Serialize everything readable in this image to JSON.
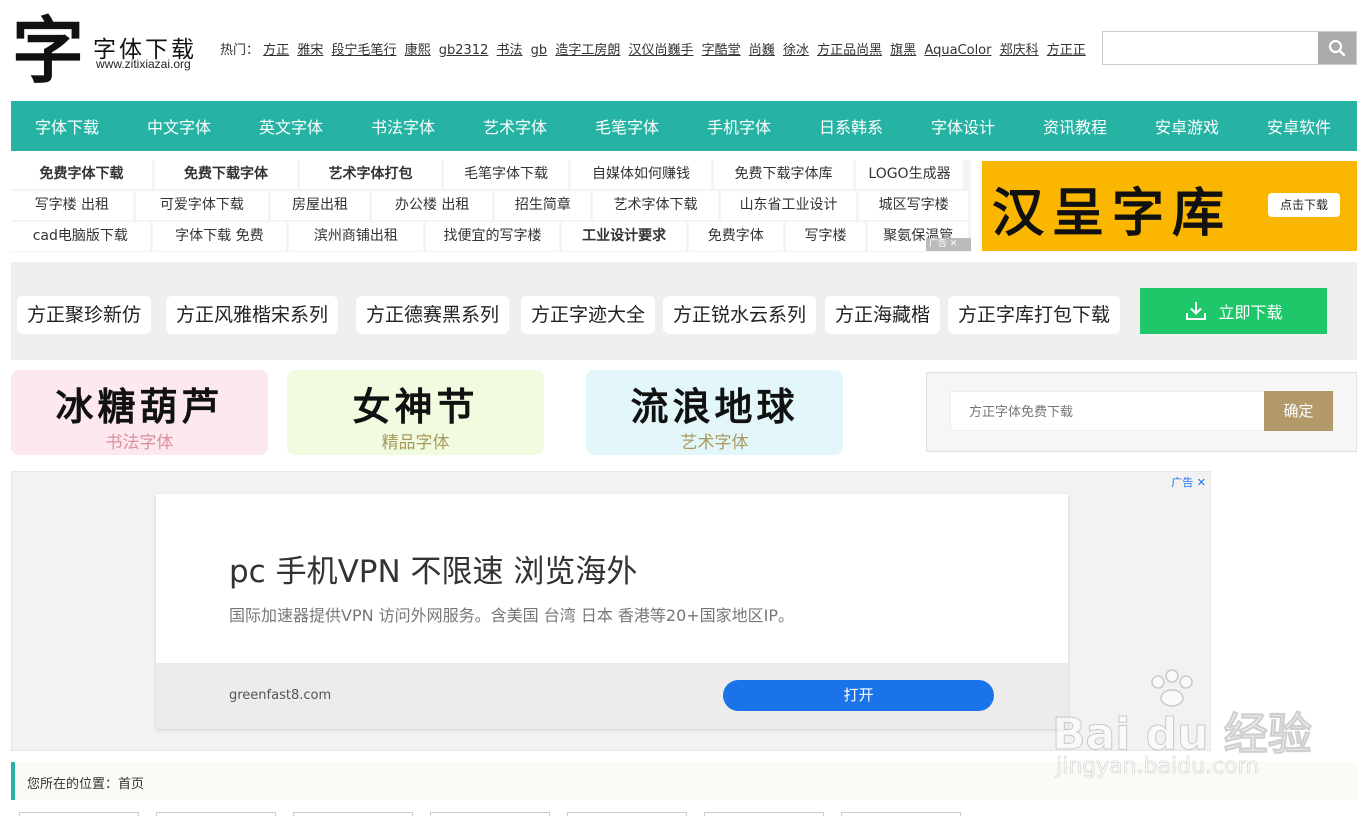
{
  "header": {
    "logo_glyph": "字",
    "logo_title": "字体下载",
    "logo_url": "www.zitixiazai.org",
    "hot_label": "热门：",
    "hot_links": [
      "方正",
      "雅宋",
      "段宁毛笔行",
      "康熙",
      "gb2312",
      "书法",
      "gb",
      "造字工房朗",
      "汉仪尚巍手",
      "字酷堂",
      "尚巍",
      "徐冰",
      "方正品尚黑",
      "旗黑",
      "AquaColor",
      "郑庆科",
      "方正正"
    ],
    "search_placeholder": ""
  },
  "nav": [
    "字体下载",
    "中文字体",
    "英文字体",
    "书法字体",
    "艺术字体",
    "毛笔字体",
    "手机字体",
    "日系韩系",
    "字体设计",
    "资讯教程",
    "安卓游戏",
    "安卓软件"
  ],
  "keywords": {
    "rows": [
      [
        "免费字体下载",
        "免费下载字体",
        "艺术字体打包",
        "毛笔字体下载",
        "自媒体如何赚钱",
        "免费下载字体库",
        "LOGO生成器"
      ],
      [
        "写字楼 出租",
        "可爱字体下载",
        "房屋出租",
        "办公楼 出租",
        "招生简章",
        "艺术字体下载",
        "山东省工业设计",
        "城区写字楼"
      ],
      [
        "cad电脑版下载",
        "字体下载 免费",
        "滨州商铺出租",
        "找便宜的写字楼",
        "工业设计要求",
        "免费字体",
        "写字楼",
        "聚氨保温管"
      ]
    ],
    "ad_mark": "广告"
  },
  "banner": {
    "text": "汉呈字库",
    "button": "点击下载"
  },
  "pills": [
    "方正聚珍新仿",
    "方正风雅楷宋系列",
    "方正德赛黑系列",
    "方正字迹大全",
    "方正锐水云系列",
    "方正海藏楷",
    "方正字库打包下载"
  ],
  "download_button": "立即下载",
  "cards": [
    {
      "big": "冰糖葫芦",
      "sub": "书法字体",
      "bg": "#fde8ef",
      "color": "#d9919c"
    },
    {
      "big": "女神节",
      "sub": "精品字体",
      "bg": "#f0fbe0",
      "color": "#a89a5e"
    },
    {
      "big": "流浪地球",
      "sub": "艺术字体",
      "bg": "#e3f7fb",
      "color": "#a89a5e"
    }
  ],
  "search_box": {
    "placeholder": "方正字体免费下载",
    "button": "确定"
  },
  "ad": {
    "label": "广告",
    "title": "pc 手机VPN 不限速 浏览海外",
    "desc": "国际加速器提供VPN 访问外网服务。含美国 台湾 日本 香港等20+国家地区IP。",
    "domain": "greenfast8.com",
    "button": "打开"
  },
  "breadcrumb": "您所在的位置：首页",
  "watermark": {
    "big": "Bai du 经验",
    "small": "jingyan.baidu.com"
  },
  "colors": {
    "nav_bg": "#26b3a4",
    "banner_bg": "#fbb600",
    "download_bg": "#1ec76a",
    "confirm_bg": "#b29a6b",
    "ad_button": "#1a73e8"
  }
}
